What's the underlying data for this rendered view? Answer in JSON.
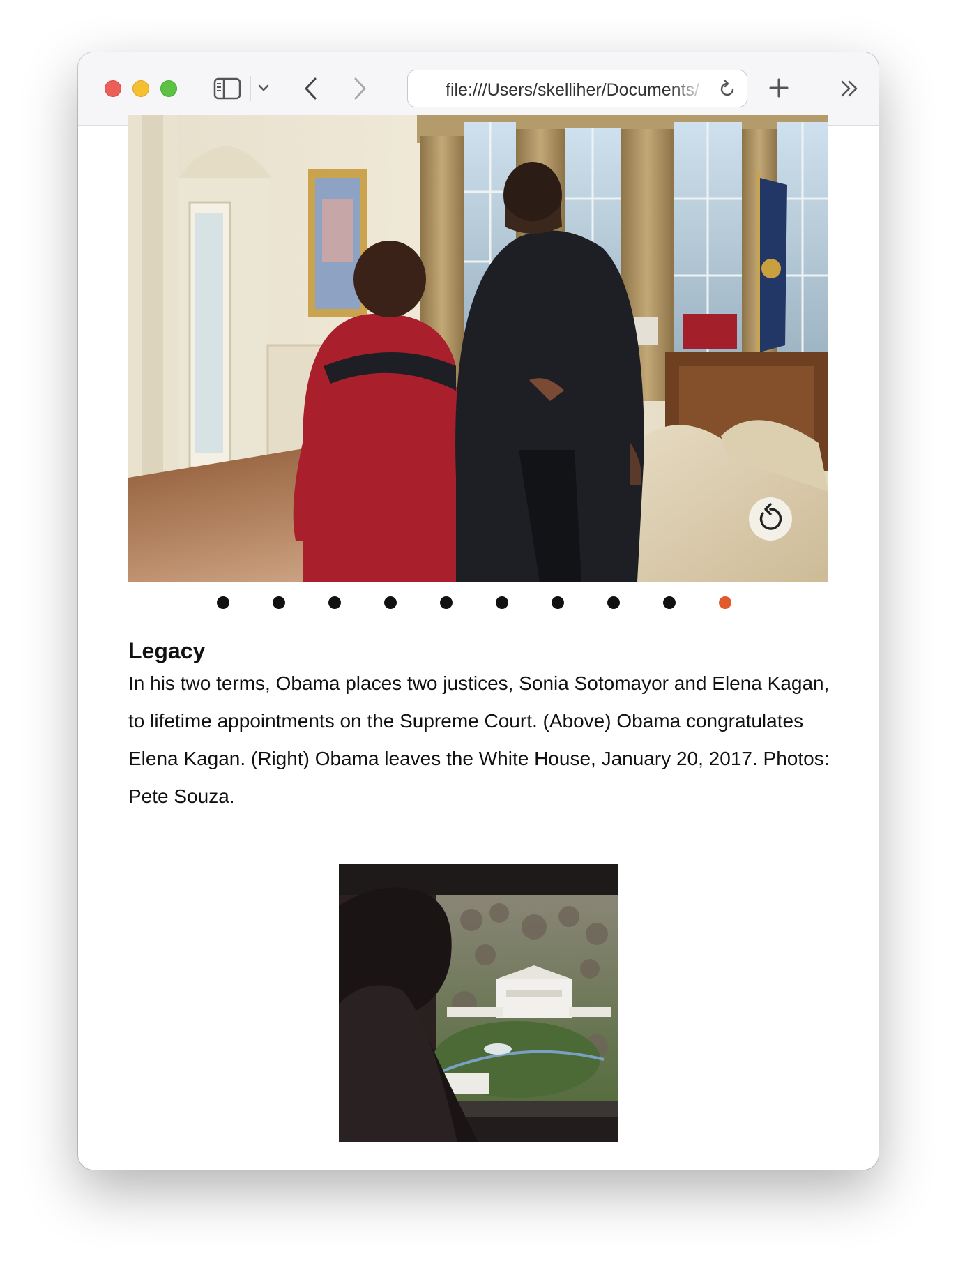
{
  "browser": {
    "url": "file:///Users/skelliher/Documents/"
  },
  "slideshow": {
    "total_slides": 10,
    "active_index": 9,
    "colors": {
      "dot": "#111111",
      "active_dot": "#e05a2c"
    }
  },
  "caption": {
    "heading": "Legacy",
    "body": "In his two terms, Obama places two justices, Sonia Sotomayor and Elena Kagan, to lifetime appointments on the Supreme Court. (Above) Obama congratulates Elena Kagan. (Right) Obama leaves the White House, January 20, 2017. Photos: Pete Souza."
  },
  "icons": {
    "sidebar": "sidebar-icon",
    "chevron": "chevron-down-icon",
    "back": "back-arrow-icon",
    "forward": "forward-arrow-icon",
    "reload": "reload-icon",
    "new_tab": "plus-icon",
    "overflow": "double-chevron-icon",
    "replay": "replay-icon"
  }
}
